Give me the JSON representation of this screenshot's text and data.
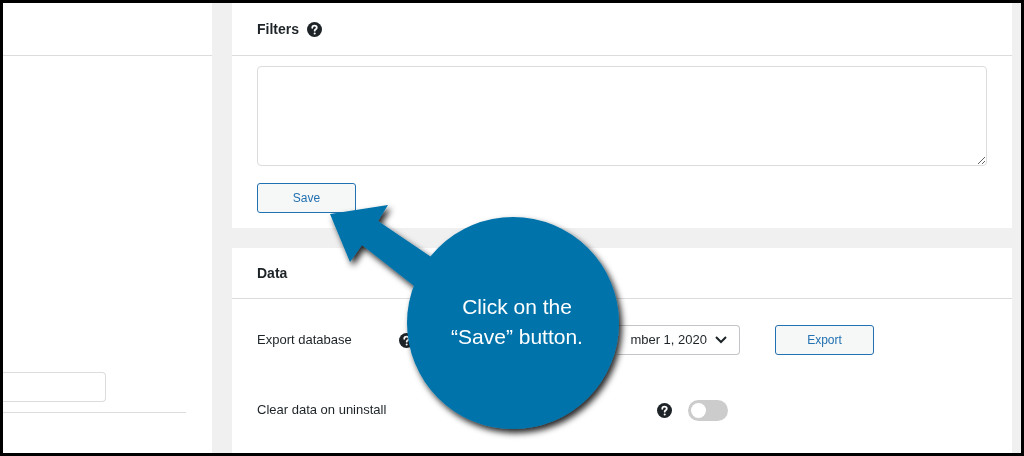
{
  "filters": {
    "title": "Filters",
    "button": "Save"
  },
  "data": {
    "title": "Data",
    "rows": [
      {
        "kind": "select",
        "label": "Export database",
        "value": "mber 1, 2020",
        "button": "Export"
      },
      {
        "kind": "toggle",
        "label": "Clear data on uninstall",
        "on": false
      }
    ]
  },
  "callout": {
    "text": "Click on the “Save” button."
  }
}
